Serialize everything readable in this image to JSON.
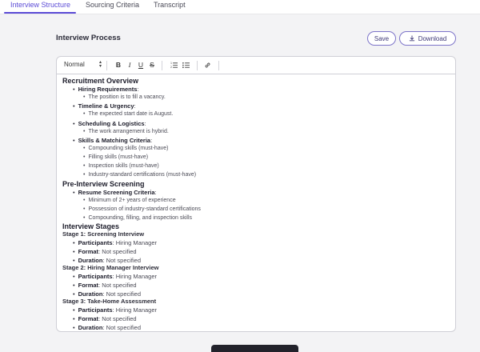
{
  "tabs": [
    {
      "label": "Interview Structure",
      "active": true
    },
    {
      "label": "Sourcing Criteria",
      "active": false
    },
    {
      "label": "Transcript",
      "active": false
    }
  ],
  "page_title": "Interview Process",
  "actions": {
    "save": "Save",
    "download": "Download"
  },
  "toolbar": {
    "style_select": "Normal",
    "bold": "B",
    "italic": "I",
    "underline": "U",
    "strike": "S"
  },
  "doc": {
    "recruitment": {
      "heading": "Recruitment Overview",
      "hiring": {
        "label": "Hiring Requirements",
        "item": "The position is to fill a vacancy."
      },
      "timeline": {
        "label": "Timeline & Urgency",
        "item": "The expected start date is August."
      },
      "scheduling": {
        "label": "Scheduling & Logistics",
        "item": "The work arrangement is hybrid."
      },
      "skills": {
        "label": "Skills & Matching Criteria",
        "items": [
          "Compounding skills (must-have)",
          "Filling skills (must-have)",
          "Inspection skills (must-have)",
          "Industry-standard certifications (must-have)"
        ]
      }
    },
    "screening": {
      "heading": "Pre-Interview Screening",
      "label": "Resume Screening Criteria",
      "items": [
        "Minimum of 2+ years of experience",
        "Possession of industry-standard certifications",
        "Compounding, filling, and inspection skills"
      ]
    },
    "stages": {
      "heading": "Interview Stages",
      "list": [
        {
          "title": "Stage 1: Screening Interview",
          "participants": "Hiring Manager",
          "format": "Not specified",
          "duration": "Not specified"
        },
        {
          "title": "Stage 2: Hiring Manager Interview",
          "participants": "Hiring Manager",
          "format": "Not specified",
          "duration": "Not specified"
        },
        {
          "title": "Stage 3: Take-Home Assessment",
          "participants": "Hiring Manager",
          "format": "Not specified",
          "duration": "Not specified"
        }
      ],
      "participants_label": "Participants",
      "format_label": "Format",
      "duration_label": "Duration"
    }
  },
  "colors": {
    "accent": "#5b4bd6",
    "border": "#cfcfd6",
    "background": "#f3f3f5"
  }
}
